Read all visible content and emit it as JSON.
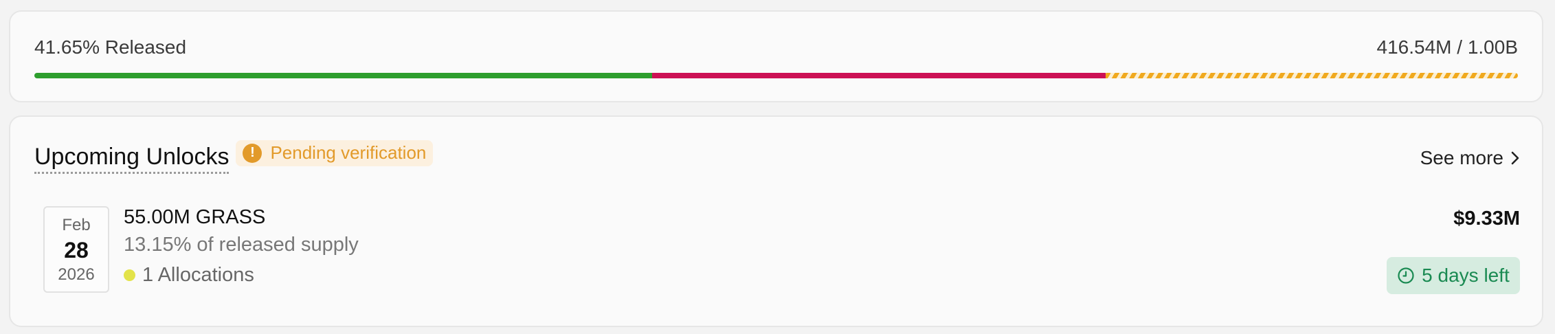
{
  "progress": {
    "released_label": "41.65% Released",
    "supply_label": "416.54M / 1.00B",
    "released_fraction": 0.4165,
    "upcoming_fraction": 0.3055,
    "remaining_fraction": 0.278,
    "colors": {
      "released": "#2e9e2e",
      "upcoming": "#cc1155",
      "remaining": "#f0a91e"
    }
  },
  "unlocks": {
    "title": "Upcoming Unlocks",
    "pending_badge": "Pending verification",
    "pending_icon": "warning-icon",
    "see_more": "See more",
    "see_more_icon": "chevron-right-icon",
    "items": [
      {
        "date": {
          "month": "Feb",
          "day": "28",
          "year": "2026"
        },
        "amount": "55.00M GRASS",
        "supply_pct": "13.15% of released supply",
        "allocations": "1 Allocations",
        "allocation_dot_color": "#e3e34a",
        "value": "$9.33M",
        "time_left": "5 days left",
        "time_icon": "clock-icon"
      }
    ]
  }
}
